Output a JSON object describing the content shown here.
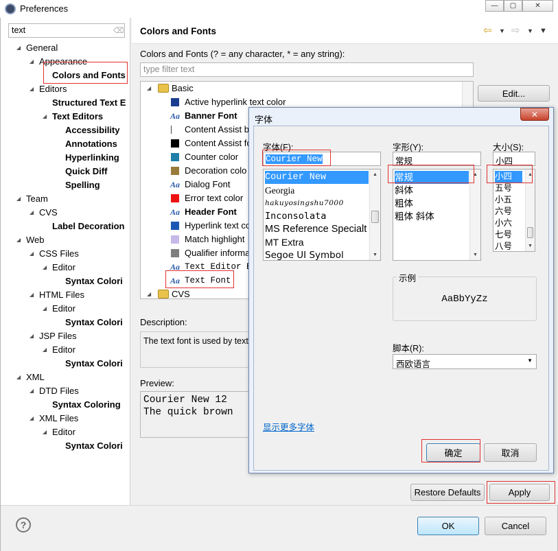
{
  "window": {
    "title": "Preferences"
  },
  "left": {
    "search_value": "text",
    "tree": [
      {
        "label": "General",
        "level": 0,
        "twisty": "open",
        "bold": false
      },
      {
        "label": "Appearance",
        "level": 1,
        "twisty": "open",
        "bold": false
      },
      {
        "label": "Colors and Fonts",
        "level": 2,
        "twisty": "",
        "bold": true,
        "selected": true
      },
      {
        "label": "Editors",
        "level": 1,
        "twisty": "open",
        "bold": false
      },
      {
        "label": "Structured Text E",
        "level": 2,
        "twisty": "",
        "bold": true
      },
      {
        "label": "Text Editors",
        "level": 2,
        "twisty": "open",
        "bold": true
      },
      {
        "label": "Accessibility",
        "level": 3,
        "twisty": "",
        "bold": true
      },
      {
        "label": "Annotations",
        "level": 3,
        "twisty": "",
        "bold": true
      },
      {
        "label": "Hyperlinking",
        "level": 3,
        "twisty": "",
        "bold": true
      },
      {
        "label": "Quick Diff",
        "level": 3,
        "twisty": "",
        "bold": true
      },
      {
        "label": "Spelling",
        "level": 3,
        "twisty": "",
        "bold": true
      },
      {
        "label": "Team",
        "level": 0,
        "twisty": "open",
        "bold": false
      },
      {
        "label": "CVS",
        "level": 1,
        "twisty": "open",
        "bold": false
      },
      {
        "label": "Label Decoration",
        "level": 2,
        "twisty": "",
        "bold": true
      },
      {
        "label": "Web",
        "level": 0,
        "twisty": "open",
        "bold": false
      },
      {
        "label": "CSS Files",
        "level": 1,
        "twisty": "open",
        "bold": false
      },
      {
        "label": "Editor",
        "level": 2,
        "twisty": "open",
        "bold": false
      },
      {
        "label": "Syntax Colori",
        "level": 3,
        "twisty": "",
        "bold": true
      },
      {
        "label": "HTML Files",
        "level": 1,
        "twisty": "open",
        "bold": false
      },
      {
        "label": "Editor",
        "level": 2,
        "twisty": "open",
        "bold": false
      },
      {
        "label": "Syntax Colori",
        "level": 3,
        "twisty": "",
        "bold": true
      },
      {
        "label": "JSP Files",
        "level": 1,
        "twisty": "open",
        "bold": false
      },
      {
        "label": "Editor",
        "level": 2,
        "twisty": "open",
        "bold": false
      },
      {
        "label": "Syntax Colori",
        "level": 3,
        "twisty": "",
        "bold": true
      },
      {
        "label": "XML",
        "level": 0,
        "twisty": "open",
        "bold": false
      },
      {
        "label": "DTD Files",
        "level": 1,
        "twisty": "open",
        "bold": false
      },
      {
        "label": "Syntax Coloring",
        "level": 2,
        "twisty": "",
        "bold": true
      },
      {
        "label": "XML Files",
        "level": 1,
        "twisty": "open",
        "bold": false
      },
      {
        "label": "Editor",
        "level": 2,
        "twisty": "open",
        "bold": false
      },
      {
        "label": "Syntax Colori",
        "level": 3,
        "twisty": "",
        "bold": true
      }
    ]
  },
  "page": {
    "title": "Colors and Fonts",
    "subtitle": "Colors and Fonts (? = any character, * = any string):",
    "filter_placeholder": "type filter text",
    "edit_label": "Edit...",
    "description_label": "Description:",
    "description_text": "The text font is used by text",
    "preview_label": "Preview:",
    "preview_line1": "Courier New 12",
    "preview_line2": "The quick brown",
    "restore_defaults": "Restore Defaults",
    "apply": "Apply"
  },
  "colors_tree": [
    {
      "label": "Basic",
      "kind": "folder",
      "level": 0,
      "bold": false
    },
    {
      "label": "Active hyperlink text color",
      "kind": "color",
      "color": "#1a3d8f",
      "level": 1,
      "bold": false
    },
    {
      "label": "Banner Font",
      "kind": "font",
      "level": 1,
      "bold": true
    },
    {
      "label": "Content Assist b",
      "kind": "color",
      "color": "#ffffff",
      "level": 1,
      "bold": false
    },
    {
      "label": "Content Assist fo",
      "kind": "color",
      "color": "#000000",
      "level": 1,
      "bold": false
    },
    {
      "label": "Counter color",
      "kind": "color",
      "color": "#1e7fa8",
      "level": 1,
      "bold": false
    },
    {
      "label": "Decoration colo",
      "kind": "color",
      "color": "#9a7a3a",
      "level": 1,
      "bold": false
    },
    {
      "label": "Dialog Font",
      "kind": "font",
      "level": 1,
      "bold": false
    },
    {
      "label": "Error text color",
      "kind": "color",
      "color": "#ee1111",
      "level": 1,
      "bold": false
    },
    {
      "label": "Header Font",
      "kind": "font",
      "level": 1,
      "bold": true
    },
    {
      "label": "Hyperlink text co",
      "kind": "color",
      "color": "#1a58b4",
      "level": 1,
      "bold": false
    },
    {
      "label": "Match highlight",
      "kind": "color",
      "color": "#c6b8e8",
      "level": 1,
      "bold": false
    },
    {
      "label": "Qualifier informa",
      "kind": "color",
      "color": "#7f7f7f",
      "level": 1,
      "bold": false
    },
    {
      "label": "Text Editor Bl",
      "kind": "font",
      "level": 1,
      "bold": false,
      "mono": true
    },
    {
      "label": "Text Font",
      "kind": "font",
      "level": 1,
      "bold": false,
      "mono": true
    },
    {
      "label": "CVS",
      "kind": "folder",
      "level": 0,
      "bold": false
    }
  ],
  "font_dialog": {
    "title": "字体",
    "close": "✕",
    "font_label": "字体(F):",
    "font_value": "Courier New",
    "font_list": [
      "Courier New",
      "Georgia",
      "hakuyosingshu7000",
      "Inconsolata",
      "MS Reference Specialt",
      "MT Extra",
      "Segoe UI Symbol"
    ],
    "style_label": "字形(Y):",
    "style_value": "常规",
    "style_list": [
      "常规",
      "斜体",
      "粗体",
      "粗体 斜体"
    ],
    "size_label": "大小(S):",
    "size_value": "小四",
    "size_list": [
      "小四",
      "五号",
      "小五",
      "六号",
      "小六",
      "七号",
      "八号"
    ],
    "sample_label": "示例",
    "sample_text": "AaBbYyZz",
    "script_label": "脚本(R):",
    "script_value": "西欧语言",
    "more_fonts": "显示更多字体",
    "ok": "确定",
    "cancel": "取消"
  },
  "footer": {
    "help": "?",
    "ok": "OK",
    "cancel": "Cancel"
  }
}
